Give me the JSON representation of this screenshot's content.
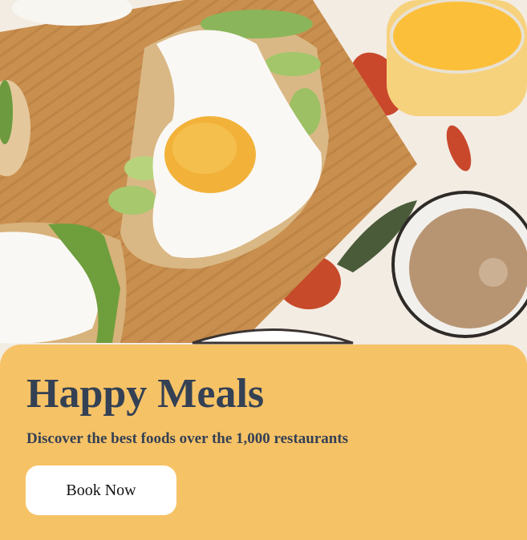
{
  "hero": {
    "image_description": "Breakfast table with fried eggs on avocado toast on a wooden board, a glass of orange juice and a cup of coffee"
  },
  "card": {
    "title": "Happy Meals",
    "subtitle": "Discover the best foods over the 1,000 restaurants",
    "button_label": "Book Now"
  },
  "colors": {
    "card_background": "#f6c266",
    "heading_text": "#344154",
    "button_background": "#ffffff"
  }
}
